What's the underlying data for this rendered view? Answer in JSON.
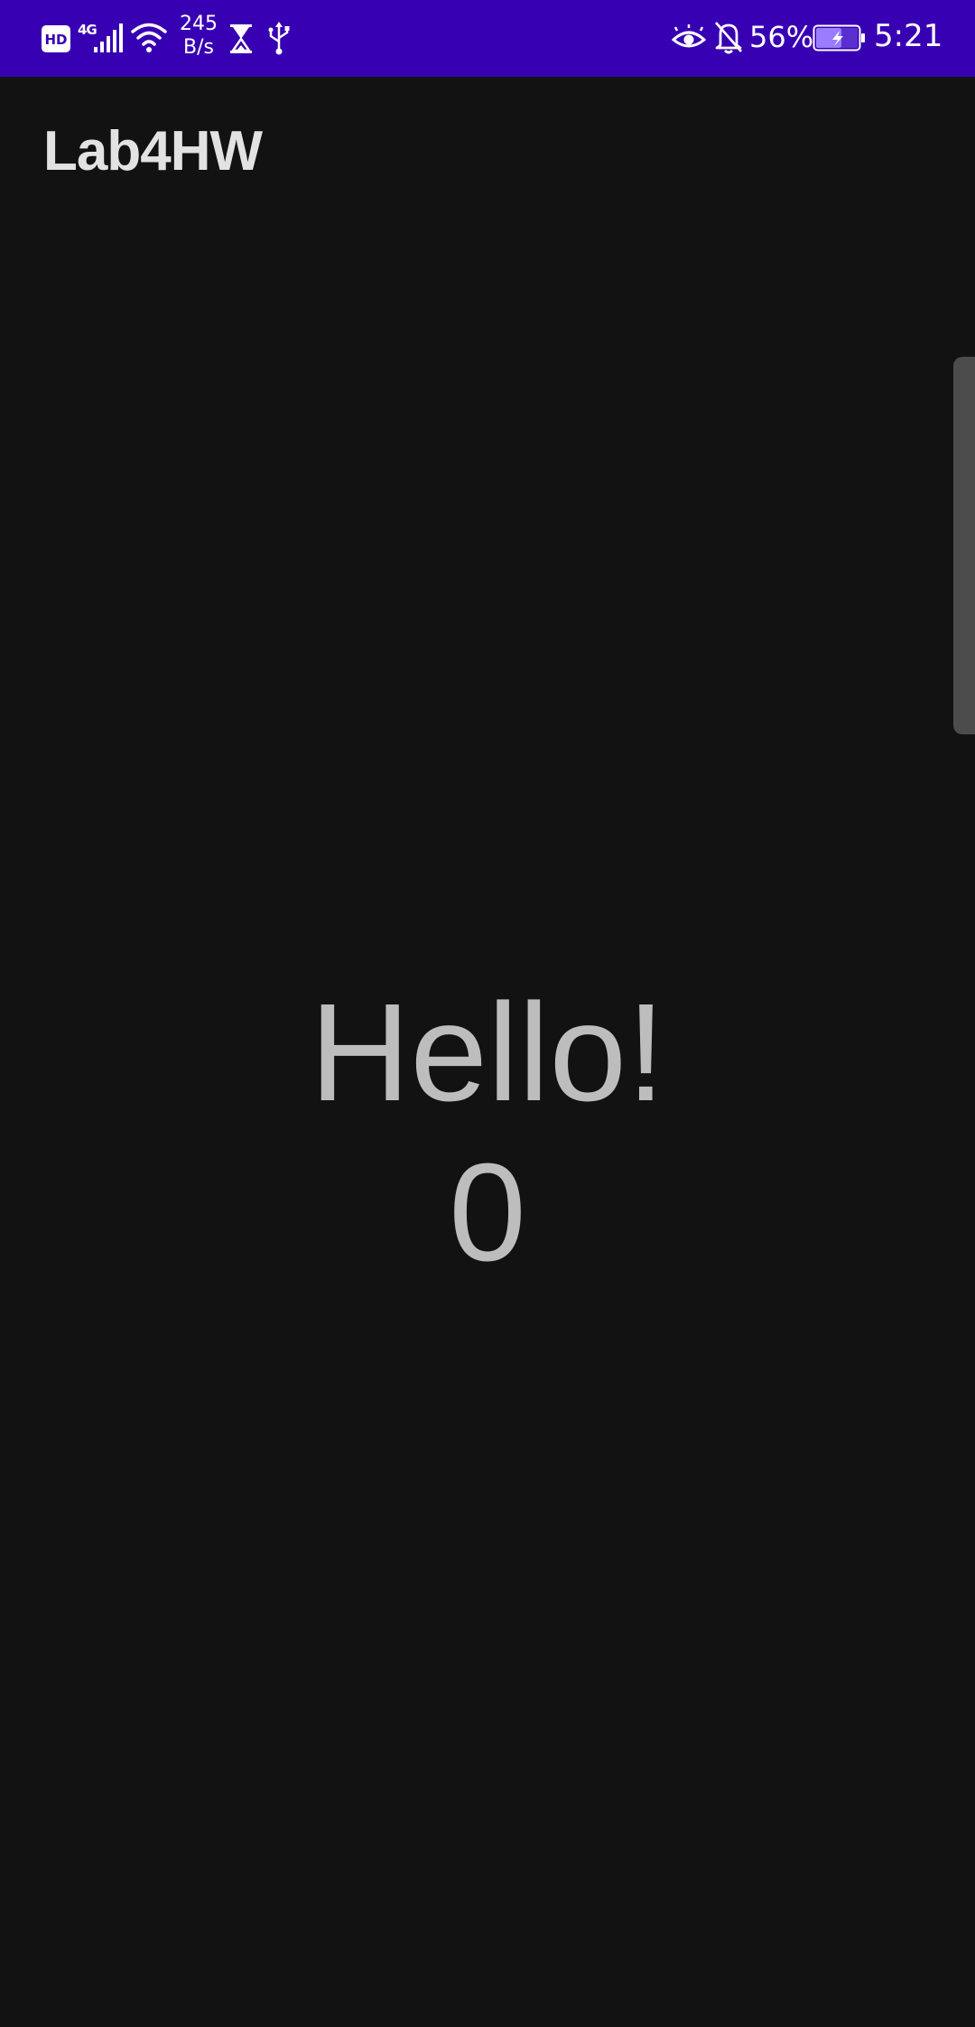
{
  "status_bar": {
    "hd_label": "HD",
    "network_type": "4G",
    "net_speed_value": "245",
    "net_speed_unit": "B/s",
    "battery_percent": "56%",
    "time": "5:21",
    "icons": [
      "hd-icon",
      "signal-icon",
      "wifi-icon",
      "hourglass-icon",
      "usb-icon",
      "eye-icon",
      "bell-off-icon",
      "battery-charging-icon"
    ],
    "background_color": "#3700B3"
  },
  "app_bar": {
    "title": "Lab4HW"
  },
  "main": {
    "greeting": "Hello!",
    "counter": "0"
  },
  "colors": {
    "background": "#121212",
    "text": "#bdbdbd",
    "title": "#e2e2e2",
    "status_bar": "#3700B3"
  }
}
